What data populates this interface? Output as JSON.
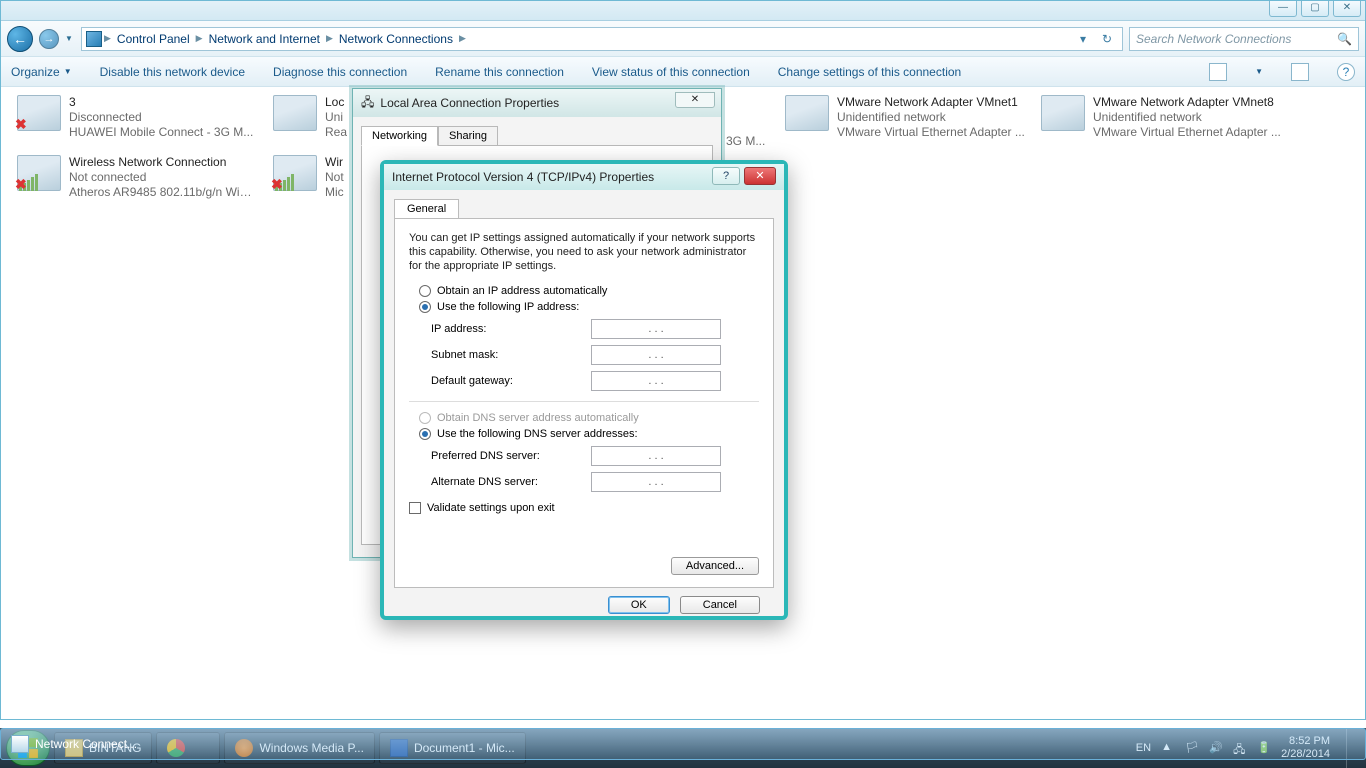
{
  "explorer": {
    "breadcrumbs": [
      "Control Panel",
      "Network and Internet",
      "Network Connections"
    ],
    "search_placeholder": "Search Network Connections",
    "cmdbar": {
      "organize": "Organize",
      "disable": "Disable this network device",
      "diagnose": "Diagnose this connection",
      "rename": "Rename this connection",
      "viewstatus": "View status of this connection",
      "changeset": "Change settings of this connection"
    }
  },
  "connections": [
    {
      "name": "3",
      "status": "Disconnected",
      "device": "HUAWEI Mobile Connect - 3G M...",
      "icon": "modem",
      "err": true
    },
    {
      "name": "Loc",
      "status": "Uni",
      "device": "Rea",
      "icon": "lan"
    },
    {
      "name": "VMware Network Adapter VMnet1",
      "status": "Unidentified network",
      "device": "VMware Virtual Ethernet Adapter ...",
      "icon": "lan"
    },
    {
      "name": "VMware Network Adapter VMnet8",
      "status": "Unidentified network",
      "device": "VMware Virtual Ethernet Adapter ...",
      "icon": "lan"
    },
    {
      "name": "Wireless Network Connection",
      "status": "Not connected",
      "device": "Atheros AR9485 802.11b/g/n WiFi...",
      "icon": "wifi",
      "err": true
    },
    {
      "name": "Wir",
      "status": "Not",
      "device": "Mic",
      "icon": "wifi",
      "err": true
    }
  ],
  "conn_peek": {
    "trail": "3G M..."
  },
  "dlg_lac": {
    "title": "Local Area Connection Properties",
    "tabs": {
      "networking": "Networking",
      "sharing": "Sharing"
    }
  },
  "dlg_ip": {
    "title": "Internet Protocol Version 4 (TCP/IPv4) Properties",
    "tab": "General",
    "desc": "You can get IP settings assigned automatically if your network supports this capability. Otherwise, you need to ask your network administrator for the appropriate IP settings.",
    "radios": {
      "auto_ip": "Obtain an IP address automatically",
      "manual_ip": "Use the following IP address:",
      "auto_dns": "Obtain DNS server address automatically",
      "manual_dns": "Use the following DNS server addresses:"
    },
    "fields": {
      "ip": "IP address:",
      "mask": "Subnet mask:",
      "gw": "Default gateway:",
      "dns1": "Preferred DNS server:",
      "dns2": "Alternate DNS server:"
    },
    "ip_placeholder": ".     .     .",
    "validate": "Validate settings upon exit",
    "advanced": "Advanced...",
    "ok": "OK",
    "cancel": "Cancel"
  },
  "taskbar": {
    "items": [
      {
        "label": "BINTANG",
        "kind": "folder"
      },
      {
        "label": "",
        "kind": "chrome"
      },
      {
        "label": "Windows Media P...",
        "kind": "wmp"
      },
      {
        "label": "Document1 - Mic...",
        "kind": "word"
      },
      {
        "label": "Network Connect...",
        "kind": "explorer",
        "active": true
      }
    ],
    "lang": "EN",
    "time": "8:52 PM",
    "date": "2/28/2014"
  }
}
